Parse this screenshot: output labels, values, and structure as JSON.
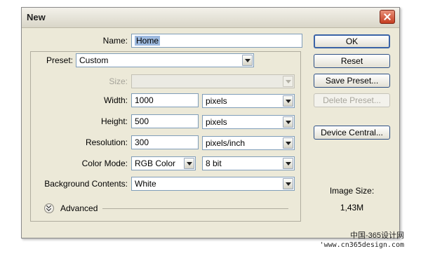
{
  "window": {
    "title": "New"
  },
  "form": {
    "name": {
      "label": "Name:",
      "value": "Home"
    },
    "preset": {
      "label": "Preset:",
      "value": "Custom"
    },
    "size": {
      "label": "Size:",
      "value": ""
    },
    "width": {
      "label": "Width:",
      "value": "1000",
      "unit": "pixels"
    },
    "height": {
      "label": "Height:",
      "value": "500",
      "unit": "pixels"
    },
    "resolution": {
      "label": "Resolution:",
      "value": "300",
      "unit": "pixels/inch"
    },
    "color_mode": {
      "label": "Color Mode:",
      "value": "RGB Color",
      "depth": "8 bit"
    },
    "background": {
      "label": "Background Contents:",
      "value": "White"
    },
    "advanced_label": "Advanced"
  },
  "buttons": {
    "ok": "OK",
    "reset": "Reset",
    "save_preset": "Save Preset...",
    "delete_preset": "Delete Preset...",
    "device_central": "Device Central..."
  },
  "image_size": {
    "label": "Image Size:",
    "value": "1,43M"
  },
  "watermark": {
    "line1": "中国-365设计网",
    "line2": "'www.cn365design.com"
  }
}
